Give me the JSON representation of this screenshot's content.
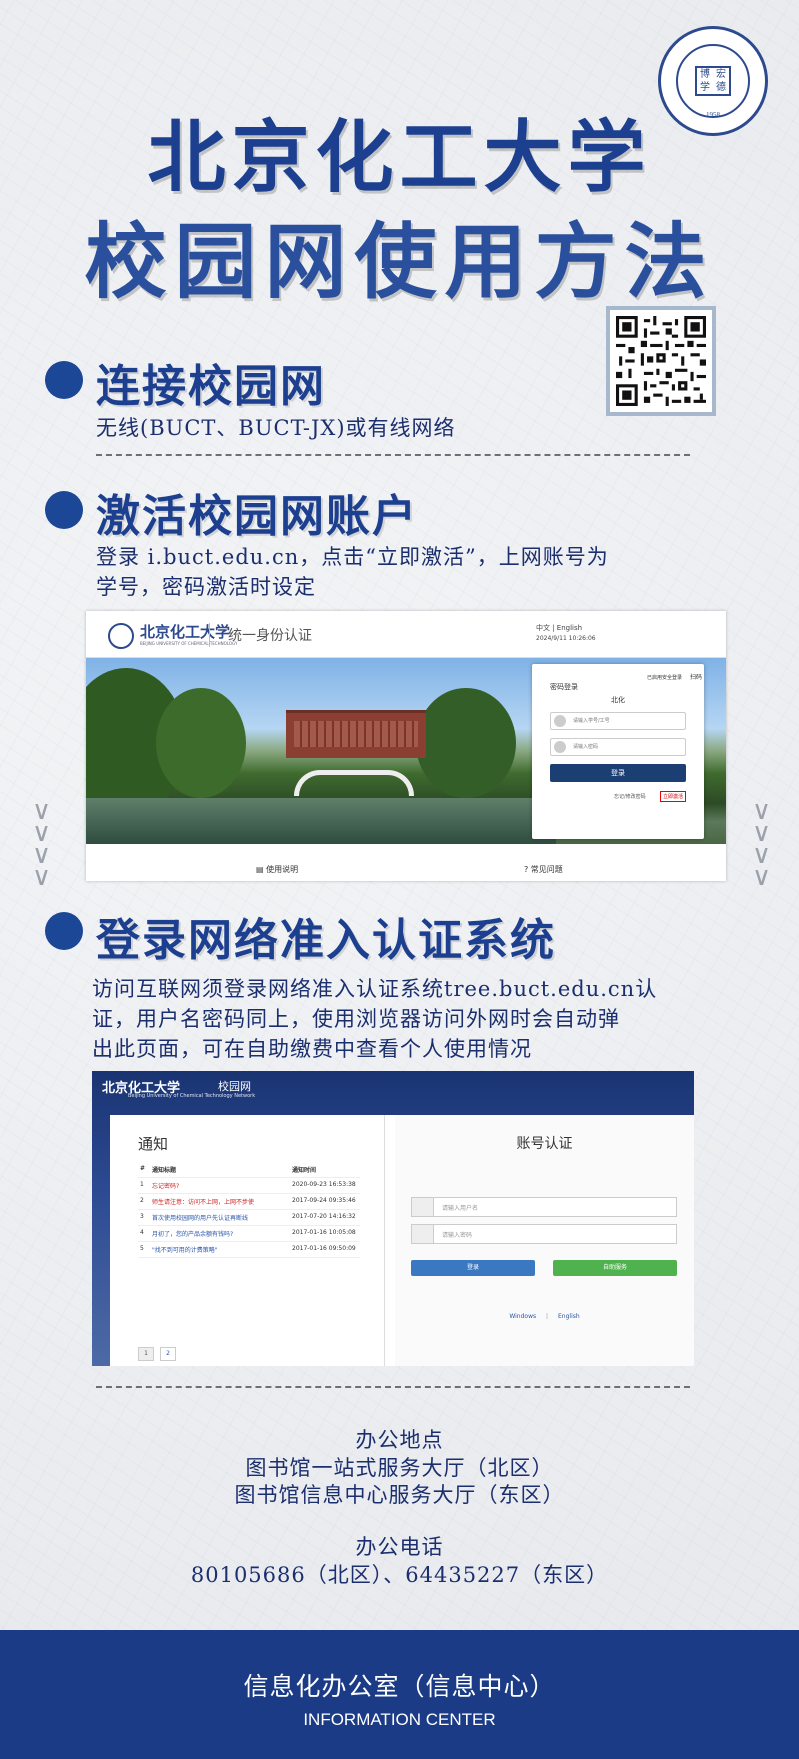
{
  "header": {
    "title_line1": "北京化工大学",
    "title_line2": "校园网使用方法",
    "seal": {
      "ring_text": "Beijing University of Chemical Technology",
      "chars": [
        "博",
        "宏",
        "学",
        "德"
      ],
      "year": "1958",
      "bottom_text": "北京化工大学"
    }
  },
  "qr_code": {
    "label": "qr-code"
  },
  "sections": [
    {
      "title": "连接校园网",
      "text": "无线(BUCT、BUCT-JX)或有线网络"
    },
    {
      "title": "激活校园网账户",
      "text_line1": "登录 i.buct.edu.cn，点击“立即激活”，上网账号为",
      "text_line2": "学号，密码激活时设定"
    },
    {
      "title": "登录网络准入认证系统",
      "text_line1": "访问互联网须登录网络准入认证系统tree.buct.edu.cn认",
      "text_line2": "证，用户名密码同上，使用浏览器访问外网时会自动弹",
      "text_line3": "出此页面，可在自助缴费中查看个人使用情况"
    }
  ],
  "screenshot1": {
    "brand": "北京化工大学",
    "brand_sub": "BEIJING UNIVERSITY OF CHEMICAL TECHNOLOGY",
    "auth_title": "统一身份认证",
    "lang": "中文 | English",
    "time": "2024/9/11 10:26:06",
    "login_tab": "密码登录",
    "badge": "已启用安全登录",
    "badge2": "扫码",
    "org": "北化",
    "user_placeholder": "请输入学号/工号",
    "pass_placeholder": "请输入密码",
    "login_button": "登录",
    "forgot": "忘记/修改密码",
    "activate": "立即激活",
    "footer_help": "使用说明",
    "footer_faq": "常见问题"
  },
  "screenshot2": {
    "brand": "北京化工大学",
    "brand2": "校园网",
    "brand_sub": "Beijing University of Chemical Technology Network",
    "notice_title": "通知",
    "col_num": "#",
    "col_title": "通知标题",
    "col_time": "通知时间",
    "rows": [
      {
        "num": "1",
        "title": "忘记密码?",
        "time": "2020-09-23 16:53:38",
        "color": "red"
      },
      {
        "num": "2",
        "title": "师生请注意：访问不上网，上网不步使",
        "time": "2017-09-24 09:35:46",
        "color": "red"
      },
      {
        "num": "3",
        "title": "首次使用校园网的用户先认证再断线",
        "time": "2017-07-20 14:16:32",
        "color": "blue"
      },
      {
        "num": "4",
        "title": "月初了，您的产品余额有钱吗?",
        "time": "2017-01-16 10:05:08",
        "color": "blue"
      },
      {
        "num": "5",
        "title": "\"找不到可用的计费策略\"",
        "time": "2017-01-16 09:50:09",
        "color": "blue"
      }
    ],
    "pages": [
      "1",
      "2"
    ],
    "account_title": "账号认证",
    "user_placeholder": "请输入用户名",
    "pass_placeholder": "请输入密码",
    "login_button": "登录",
    "self_service_button": "自助服务",
    "link_windows": "Windows",
    "link_english": "English"
  },
  "office": {
    "location_label": "办公地点",
    "location1": "图书馆一站式服务大厅（北区）",
    "location2": "图书馆信息中心服务大厅（东区）",
    "phone_label": "办公电话",
    "phones": "80105686（北区）、64435227（东区）"
  },
  "footer": {
    "cn": "信息化办公室（信息中心）",
    "en": "INFORMATION CENTER"
  },
  "colors": {
    "primary": "#1c3f8f",
    "footer_bg": "#1b3b87",
    "background": "#eeeff1"
  }
}
